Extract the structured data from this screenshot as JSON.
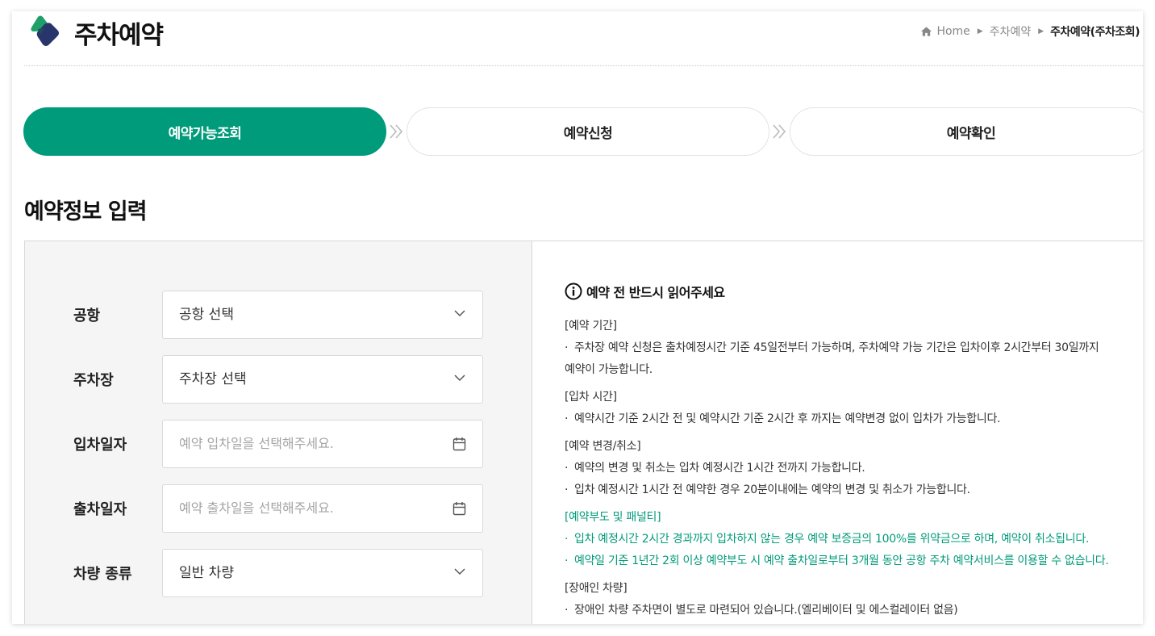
{
  "header": {
    "title": "주차예약",
    "breadcrumb": [
      "Home",
      "주차예약",
      "주차예약(주차조회)"
    ]
  },
  "steps": [
    {
      "label": "예약가능조회",
      "active": true
    },
    {
      "label": "예약신청",
      "active": false
    },
    {
      "label": "예약확인",
      "active": false
    }
  ],
  "section_title": "예약정보 입력",
  "form": {
    "airport": {
      "label": "공항",
      "value": "공항 선택"
    },
    "parking": {
      "label": "주차장",
      "value": "주차장 선택"
    },
    "entry_date": {
      "label": "입차일자",
      "placeholder": "예약 입차일을 선택해주세요."
    },
    "exit_date": {
      "label": "출차일자",
      "placeholder": "예약 출차일을 선택해주세요."
    },
    "vehicle_type": {
      "label": "차량 종류",
      "value": "일반 차량"
    }
  },
  "notice": {
    "heading": "예약 전 반드시 읽어주세요",
    "sections": [
      {
        "title": "[예약 기간]",
        "lines": [
          "주차장 예약 신청은 출차예정시간 기준 45일전부터 가능하며, 주차예약 가능 기간은 입차이후 2시간부터 30일까지",
          "예약이 가능합니다."
        ]
      },
      {
        "title": "[입차 시간]",
        "lines": [
          "예약시간 기준 2시간 전 및 예약시간 기준 2시간 후 까지는 예약변경 없이 입차가 가능합니다."
        ]
      },
      {
        "title": "[예약 변경/취소]",
        "lines": [
          "예약의 변경 및 취소는 입차 예정시간 1시간 전까지 가능합니다.",
          "입차 예정시간 1시간 전 예약한 경우 20분이내에는 예약의 변경 및 취소가 가능합니다."
        ]
      },
      {
        "title": "[예약부도 및 패널티]",
        "lines": [
          "입차 예정시간 2시간 경과까지 입차하지 않는 경우 예약 보증금의 100%를 위약금으로 하며, 예약이 취소됩니다.",
          "예약일 기준 1년간 2회 이상 예약부도 시 예약 출차일로부터 3개월 동안 공항 주차 예약서비스를 이용할 수 없습니다."
        ]
      },
      {
        "title": "[장애인 차량]",
        "lines": [
          "장애인 차량 주차면이 별도로 마련되어 있습니다.(엘리베이터 및 에스컬레이터 없음)"
        ]
      }
    ]
  },
  "colors": {
    "accent": "#009b7a",
    "text": "#222222",
    "panel": "#f5f5f5"
  }
}
